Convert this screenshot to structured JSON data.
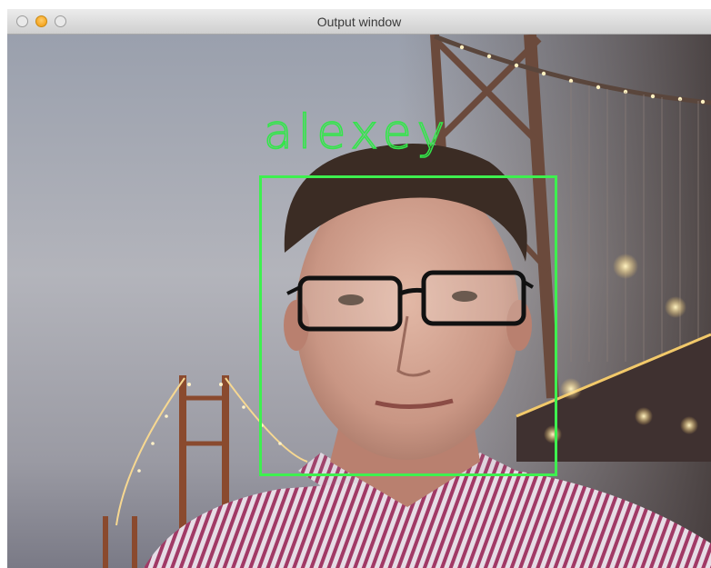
{
  "window": {
    "title": "Output window",
    "buttons": [
      "close",
      "minimize",
      "zoom"
    ]
  },
  "detection": {
    "label": "alexey",
    "box_color": "#3ef04f",
    "label_color": "#33e64a"
  },
  "icons": {
    "close": "close-icon",
    "minimize": "minimize-icon",
    "zoom": "zoom-icon"
  }
}
